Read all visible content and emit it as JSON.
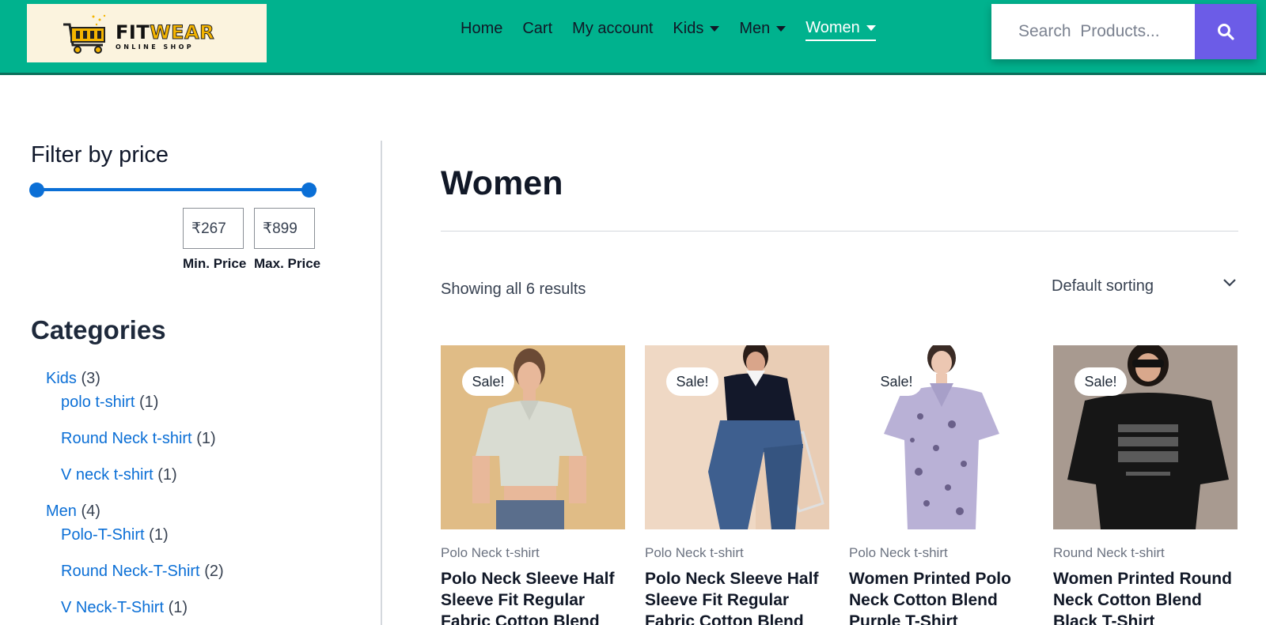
{
  "header": {
    "logo": {
      "brand_fit": "FIT",
      "brand_wear": "WEAR",
      "tagline": "ONLINE SHOP"
    },
    "nav": [
      {
        "label": "Home",
        "has_dropdown": false,
        "active": false
      },
      {
        "label": "Cart",
        "has_dropdown": false,
        "active": false
      },
      {
        "label": "My account",
        "has_dropdown": false,
        "active": false
      },
      {
        "label": "Kids",
        "has_dropdown": true,
        "active": false
      },
      {
        "label": "Men",
        "has_dropdown": true,
        "active": false
      },
      {
        "label": "Women",
        "has_dropdown": true,
        "active": true
      }
    ],
    "search": {
      "placeholder": "Search  Products...",
      "value": "",
      "icon": "search-icon"
    },
    "colors": {
      "header_bg": "#00b28e",
      "search_button": "#6c5ce7"
    }
  },
  "sidebar": {
    "filter": {
      "title": "Filter by price",
      "min_value": "₹267",
      "max_value": "₹899",
      "min_label": "Min. Price",
      "max_label": "Max. Price",
      "range_low_fraction": 0,
      "range_high_fraction": 1
    },
    "categories_title": "Categories",
    "categories": [
      {
        "name": "Kids",
        "count": "(3)",
        "level": 0
      },
      {
        "name": "polo t-shirt",
        "count": "(1)",
        "level": 1
      },
      {
        "name": "Round Neck t-shirt",
        "count": "(1)",
        "level": 1
      },
      {
        "name": "V neck t-shirt",
        "count": "(1)",
        "level": 1
      },
      {
        "name": "Men",
        "count": "(4)",
        "level": 0
      },
      {
        "name": "Polo-T-Shirt",
        "count": "(1)",
        "level": 1
      },
      {
        "name": "Round Neck-T-Shirt",
        "count": "(2)",
        "level": 1
      },
      {
        "name": "V Neck-T-Shirt",
        "count": "(1)",
        "level": 1
      }
    ]
  },
  "main": {
    "title": "Women",
    "result_count": "Showing all 6 results",
    "sort": {
      "selected": "Default sorting"
    },
    "products": [
      {
        "badge": "Sale!",
        "category": "Polo Neck t-shirt",
        "name": "Polo Neck Sleeve Half Sleeve Fit Regular Fabric Cotton Blend"
      },
      {
        "badge": "Sale!",
        "category": "Polo Neck t-shirt",
        "name": "Polo Neck Sleeve Half Sleeve Fit Regular Fabric Cotton Blend"
      },
      {
        "badge": "Sale!",
        "category": "Polo Neck t-shirt",
        "name": "Women Printed Polo Neck Cotton Blend Purple T-Shirt"
      },
      {
        "badge": "Sale!",
        "category": "Round Neck t-shirt",
        "name": "Women Printed Round Neck Cotton Blend Black T-Shirt"
      }
    ]
  }
}
